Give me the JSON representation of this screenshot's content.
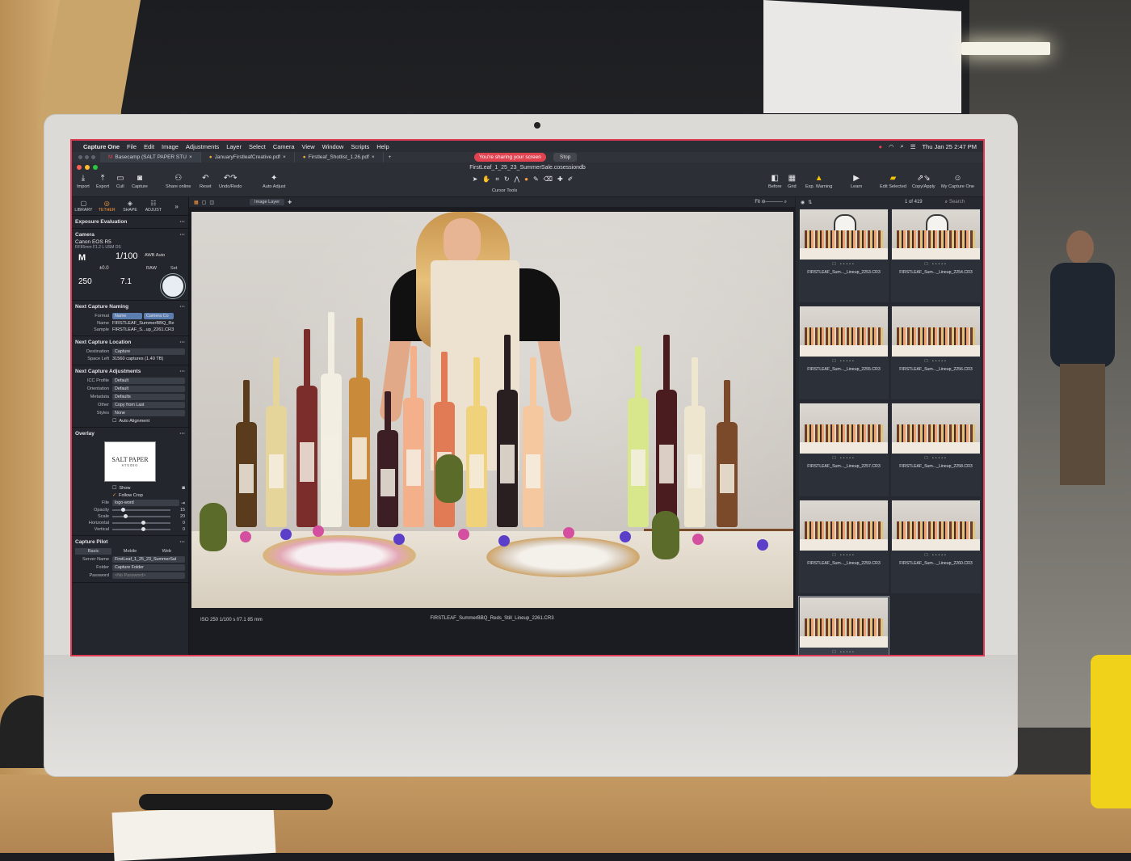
{
  "menubar": {
    "app": "Capture One",
    "items": [
      "File",
      "Edit",
      "Image",
      "Adjustments",
      "Layer",
      "Select",
      "Camera",
      "View",
      "Window",
      "Scripts",
      "Help"
    ],
    "clock": "Thu Jan 25  2:47 PM"
  },
  "browser_tabs": [
    {
      "label": "Basecamp (SALT PAPER STU"
    },
    {
      "label": "JanuaryFirstleafCreative.pdf"
    },
    {
      "label": "Firstleaf_Shotlist_1.26.pdf"
    }
  ],
  "sharing": {
    "banner": "You're sharing your screen",
    "stop": "Stop"
  },
  "window": {
    "title": "FirstLeaf_1_25_23_SummerSale.cosessiondb"
  },
  "toolbar": {
    "import": "Import",
    "export": "Export",
    "cull": "Cull",
    "capture": "Capture",
    "share_online": "Share online",
    "reset": "Reset",
    "undo_redo": "Undo/Redo",
    "auto_adjust": "Auto Adjust",
    "cursor_tools": "Cursor Tools",
    "before": "Before",
    "grid": "Grid",
    "exp_warning": "Exp. Warning",
    "learn": "Learn",
    "edit_selected": "Edit Selected",
    "copy_apply": "Copy/Apply",
    "my_capture_one": "My Capture One"
  },
  "tool_tabs": [
    "LIBRARY",
    "TETHER",
    "SHAPE",
    "ADJUST"
  ],
  "panels": {
    "exposure": "Exposure Evaluation",
    "camera": {
      "title": "Camera",
      "model": "Canon EOS R5",
      "lens": "RF85mm F1.2 L USM DS",
      "mode": "M",
      "shutter": "1/100",
      "ev": "±0.0",
      "iso": "250",
      "aperture": "7.1",
      "wb": "AWB Auto",
      "format": "RAW",
      "set": "Set"
    },
    "naming": {
      "title": "Next Capture Naming",
      "format_label": "Format",
      "format_values": [
        "Name",
        "Camera Co"
      ],
      "name_label": "Name",
      "name_value": "FIRSTLEAF_SummerBBQ_Re",
      "sample_label": "Sample",
      "sample_value": "FIRSTLEAF_S...up_2261.CR3"
    },
    "location": {
      "title": "Next Capture Location",
      "destination_label": "Destination",
      "destination_value": "Capture",
      "space_label": "Space Left",
      "space_value": "31560 captures (1.40 TB)"
    },
    "adjustments": {
      "title": "Next Capture Adjustments",
      "rows": [
        {
          "label": "ICC Profile",
          "value": "Default"
        },
        {
          "label": "Orientation",
          "value": "Default"
        },
        {
          "label": "Metadata",
          "value": "Defaults"
        },
        {
          "label": "Other",
          "value": "Copy from Last"
        },
        {
          "label": "Styles",
          "value": "None"
        }
      ],
      "auto_alignment": "Auto Alignment"
    },
    "overlay": {
      "title": "Overlay",
      "logo_line1": "SALT PAPER",
      "logo_line2": "STUDIO",
      "show": "Show",
      "follow_crop": "Follow Crop",
      "file_label": "File",
      "file_value": "logo-word",
      "sliders": [
        {
          "label": "Opacity",
          "value": "15",
          "pos": 0.15
        },
        {
          "label": "Scale",
          "value": "20",
          "pos": 0.2
        },
        {
          "label": "Horizontal",
          "value": "0",
          "pos": 0.5
        },
        {
          "label": "Vertical",
          "value": "0",
          "pos": 0.5
        }
      ]
    },
    "pilot": {
      "title": "Capture Pilot",
      "tabs": [
        "Basic",
        "Mobile",
        "Web"
      ],
      "server_label": "Server Name",
      "server_value": "FirstLeaf_1_25_23_SummerSal",
      "folder_label": "Folder",
      "folder_value": "Capture Folder",
      "password_label": "Password",
      "password_placeholder": "<No Password>"
    }
  },
  "viewer": {
    "layer": "Image Layer",
    "fit": "Fit",
    "exif": "ISO 250    1/100 s    f/7.1    85 mm",
    "filename": "FIRSTLEAF_SummerBBQ_Reds_Still_Lineup_2261.CR3"
  },
  "browser": {
    "count": "1 of 419",
    "search_placeholder": "Search",
    "thumbs": [
      {
        "name": "FIRSTLEAF_Sum..._Lineup_2253.CR3"
      },
      {
        "name": "FIRSTLEAF_Sum..._Lineup_2254.CR3"
      },
      {
        "name": "FIRSTLEAF_Sum..._Lineup_2255.CR3"
      },
      {
        "name": "FIRSTLEAF_Sum..._Lineup_2256.CR3"
      },
      {
        "name": "FIRSTLEAF_Sum..._Lineup_2257.CR3"
      },
      {
        "name": "FIRSTLEAF_Sum..._Lineup_2258.CR3"
      },
      {
        "name": "FIRSTLEAF_Sum..._Lineup_2259.CR3"
      },
      {
        "name": "FIRSTLEAF_Sum..._Lineup_2260.CR3"
      },
      {
        "name": ""
      }
    ]
  },
  "colors": {
    "accent": "#ff9a3c",
    "share_red": "#e0424f",
    "warning": "#f2c200"
  }
}
